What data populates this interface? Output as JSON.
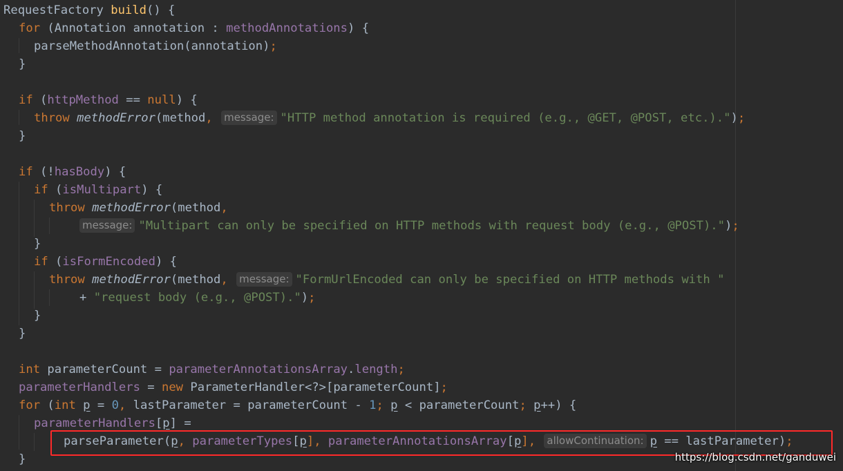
{
  "editor": {
    "l1": {
      "a": "RequestFactory ",
      "b": "build",
      "c": "() {"
    },
    "l2": {
      "a": "for",
      "b": " (Annotation annotation : ",
      "c": "methodAnnotations",
      "d": ") {"
    },
    "l3": {
      "a": "parseMethodAnnotation(annotation)",
      "b": ";"
    },
    "l4": {
      "a": "}"
    },
    "l6": {
      "a": "if",
      "b": " (",
      "c": "httpMethod",
      "d": " == ",
      "e": "null",
      "f": ") {"
    },
    "l7": {
      "a": "throw ",
      "b": "methodError",
      "c": "(",
      "d": "method",
      "e": ", ",
      "hint": "message:",
      "f": "\"HTTP method annotation is required (e.g., @GET, @POST, etc.).\"",
      "g": ")",
      "h": ";"
    },
    "l8": {
      "a": "}"
    },
    "l10": {
      "a": "if",
      "b": " (!",
      "c": "hasBody",
      "d": ") {"
    },
    "l11": {
      "a": "if",
      "b": " (",
      "c": "isMultipart",
      "d": ") {"
    },
    "l12": {
      "a": "throw ",
      "b": "methodError",
      "c": "(",
      "d": "method",
      "e": ","
    },
    "l13": {
      "hint": "message:",
      "a": "\"Multipart can only be specified on HTTP methods with request body (e.g., @POST).\"",
      "b": ")",
      "c": ";"
    },
    "l14": {
      "a": "}"
    },
    "l15": {
      "a": "if",
      "b": " (",
      "c": "isFormEncoded",
      "d": ") {"
    },
    "l16": {
      "a": "throw ",
      "b": "methodError",
      "c": "(",
      "d": "method",
      "e": ", ",
      "hint": "message:",
      "f": "\"FormUrlEncoded can only be specified on HTTP methods with \""
    },
    "l17": {
      "a": "+ ",
      "b": "\"request body (e.g., @POST).\"",
      "c": ")",
      "d": ";"
    },
    "l18": {
      "a": "}"
    },
    "l19": {
      "a": "}"
    },
    "l21": {
      "a": "int ",
      "b": "parameterCount = ",
      "c": "parameterAnnotationsArray",
      "d": ".",
      "e": "length",
      "f": ";"
    },
    "l22": {
      "a": "parameterHandlers",
      "b": " = ",
      "c": "new ",
      "d": "ParameterHandler<?>[parameterCount]",
      "e": ";"
    },
    "l23": {
      "a": "for",
      "b": " (",
      "c": "int ",
      "d": "p",
      "e": " = ",
      "f": "0",
      "g": ", ",
      "h": "lastParameter = parameterCount - ",
      "i": "1",
      "j": "; ",
      "k": "p",
      "l": " < parameterCount",
      "m": "; ",
      "n": "p",
      "o": "++) {"
    },
    "l24": {
      "a": "parameterHandlers",
      "b": "[",
      "c": "p",
      "d": "] ="
    },
    "l25": {
      "a": "parseParameter(",
      "b": "p",
      "c": ", ",
      "d": "parameterTypes",
      "e": "[",
      "f": "p",
      "g": "], ",
      "h": "parameterAnnotationsArray",
      "i": "[",
      "j": "p",
      "k": "], ",
      "hint": "allowContinuation:",
      "l": "p",
      "m": " == ",
      "n": "lastParameter)",
      "o": ";"
    },
    "l26": {
      "a": "}"
    }
  },
  "watermark": "https://blog.csdn.net/ganduwei"
}
